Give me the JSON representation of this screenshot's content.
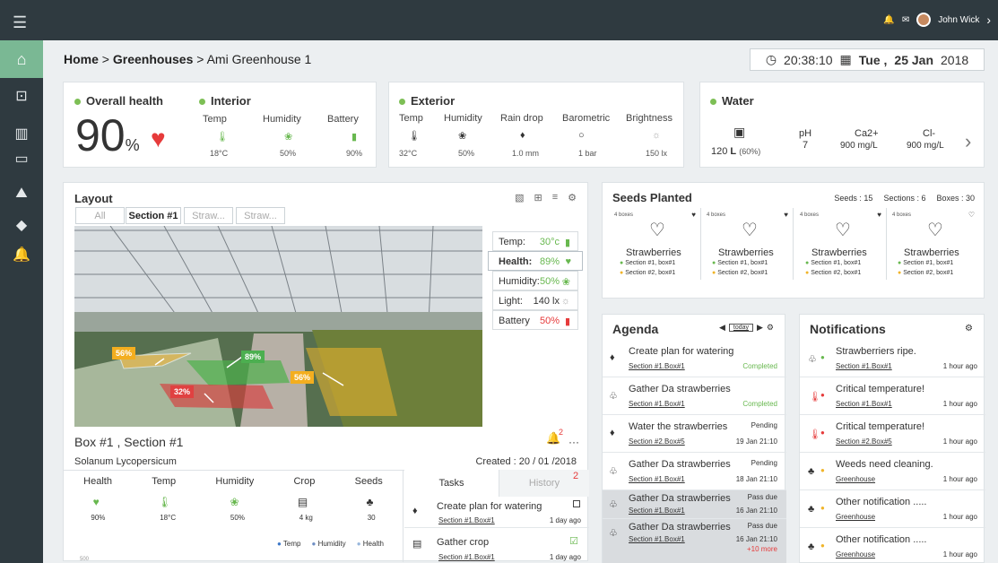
{
  "topbar": {
    "user_name": "John Wick",
    "icons": [
      "bell-icon",
      "mail-icon",
      "chevron-right-icon"
    ]
  },
  "sidebar": {
    "icons": [
      "home-icon",
      "dashboard-icon",
      "greenhouse-icon",
      "calendar-icon",
      "chart-icon",
      "tag-icon",
      "bell-icon"
    ]
  },
  "breadcrumb": {
    "home": "Home",
    "sep1": ">",
    "greenhouses": "Greenhouses",
    "sep2": ">",
    "current": "Ami Greenhouse 1"
  },
  "clock": {
    "time": "20:38:10",
    "day": "Tue ,",
    "date": "25 Jan",
    "year": "2018"
  },
  "overall": {
    "title": "Overall health",
    "value": "90",
    "unit": "%"
  },
  "interior": {
    "title": "Interior",
    "temp_label": "Temp",
    "humidity_label": "Humidity",
    "battery_label": "Battery",
    "temp_value": "18°C",
    "humidity_value": "50%",
    "battery_value": "90%"
  },
  "exterior": {
    "title": "Exterior",
    "labels": [
      "Temp",
      "Humidity",
      "Rain drop",
      "Barometric",
      "Brightness"
    ],
    "values": [
      "32°C",
      "50%",
      "1.0 mm",
      "1 bar",
      "150 lx"
    ]
  },
  "water": {
    "title": "Water",
    "tank_value": "120",
    "tank_unit": "L",
    "tank_percent": "(60%)",
    "ph_label": "pH",
    "ph_value": "7",
    "ca_label": "Ca2+",
    "ca_value": "900 mg/L",
    "cl_label": "Cl-",
    "cl_value": "900 mg/L"
  },
  "layout": {
    "title": "Layout",
    "tabs": [
      "All",
      "Section #1",
      "Straw...",
      "Straw..."
    ],
    "sensors": [
      {
        "label": "Temp:",
        "value": "30°c"
      },
      {
        "label": "Health:",
        "value": "89%"
      },
      {
        "label": "Humidity:",
        "value": "50%"
      },
      {
        "label": "Light:",
        "value": "140 lx"
      },
      {
        "label": "Battery",
        "value": "50%"
      }
    ],
    "zones": [
      "56%",
      "89%",
      "56%",
      "32%"
    ],
    "box_title": "Box #1 , Section #1",
    "species": "Solanum Lycopersicum",
    "created": "Created : 20 / 01 /2018",
    "bell_count": "2",
    "more": "···",
    "stats_labels": [
      "Health",
      "Temp",
      "Humidity",
      "Crop",
      "Seeds"
    ],
    "stats_values": [
      "90%",
      "18°C",
      "50%",
      "4 kg",
      "30"
    ],
    "legend": [
      "Temp",
      "Humidity",
      "Health"
    ],
    "y_tick": "500"
  },
  "tasks": {
    "tab_tasks": "Tasks",
    "tab_history": "History",
    "history_badge": "2",
    "items": [
      {
        "title": "Create plan for watering",
        "link": "Section #1.Box#1",
        "time": "1 day ago"
      },
      {
        "title": "Gather crop",
        "link": "Section #1.Box#1",
        "time": "1 day ago"
      }
    ]
  },
  "seeds": {
    "title": "Seeds Planted",
    "seeds_count": "Seeds : 15",
    "sections_count": "Sections : 6",
    "boxes_count": "Boxes : 30",
    "items": [
      {
        "boxes": "4 boxes",
        "name": "Strawberries",
        "s1": "Section #1, box#1",
        "s2": "Section #2, box#1"
      },
      {
        "boxes": "4 boxes",
        "name": "Strawberries",
        "s1": "Section #1, box#1",
        "s2": "Section #2, box#1"
      },
      {
        "boxes": "4 boxes",
        "name": "Strawberries",
        "s1": "Section #1, box#1",
        "s2": "Section #2, box#1"
      },
      {
        "boxes": "4 boxes",
        "name": "Strawberries",
        "s1": "Section #1, box#1",
        "s2": "Section #2, box#1"
      }
    ]
  },
  "agenda": {
    "title": "Agenda",
    "today": "today",
    "items": [
      {
        "title": "Create plan for watering",
        "link": "Section #1.Box#1",
        "status": "Completed",
        "time": ""
      },
      {
        "title": "Gather Da strawberries",
        "link": "Section #1.Box#1",
        "status": "Completed",
        "time": ""
      },
      {
        "title": "Water the strawberries",
        "link": "Section #2.Box#5",
        "status": "Pending",
        "time": "19 Jan 21:10"
      },
      {
        "title": "Gather Da strawberries",
        "link": "Section #1.Box#1",
        "status": "Pending",
        "time": "18 Jan 21:10"
      },
      {
        "title": "Gather Da strawberries",
        "link": "Section #1.Box#1",
        "status": "Pass due",
        "time": "16 Jan 21:10"
      },
      {
        "title": "Gather Da strawberries",
        "link": "Section #1.Box#1",
        "status": "Pass due",
        "time": "16 Jan 21:10"
      }
    ],
    "more": "+10 more"
  },
  "notifications": {
    "title": "Notifications",
    "items": [
      {
        "title": "Strawberriers ripe.",
        "link": "Section #1.Box#1",
        "time": "1 hour ago"
      },
      {
        "title": "Critical temperature!",
        "link": "Section #1.Box#1",
        "time": "1 hour ago"
      },
      {
        "title": "Critical temperature!",
        "link": "Section #2.Box#5",
        "time": "1 hour ago"
      },
      {
        "title": "Weeds need cleaning.",
        "link": "Greenhouse",
        "time": "1 hour ago"
      },
      {
        "title": "Other notification .....",
        "link": "Greenhouse",
        "time": "1 hour ago"
      },
      {
        "title": "Other notification .....",
        "link": "Greenhouse",
        "time": "1 hour ago"
      }
    ]
  },
  "colors": {
    "accent": "#7dbf55",
    "danger": "#e63b3b",
    "sidebar": "#2f3a40",
    "active_home": "#7ab894"
  }
}
